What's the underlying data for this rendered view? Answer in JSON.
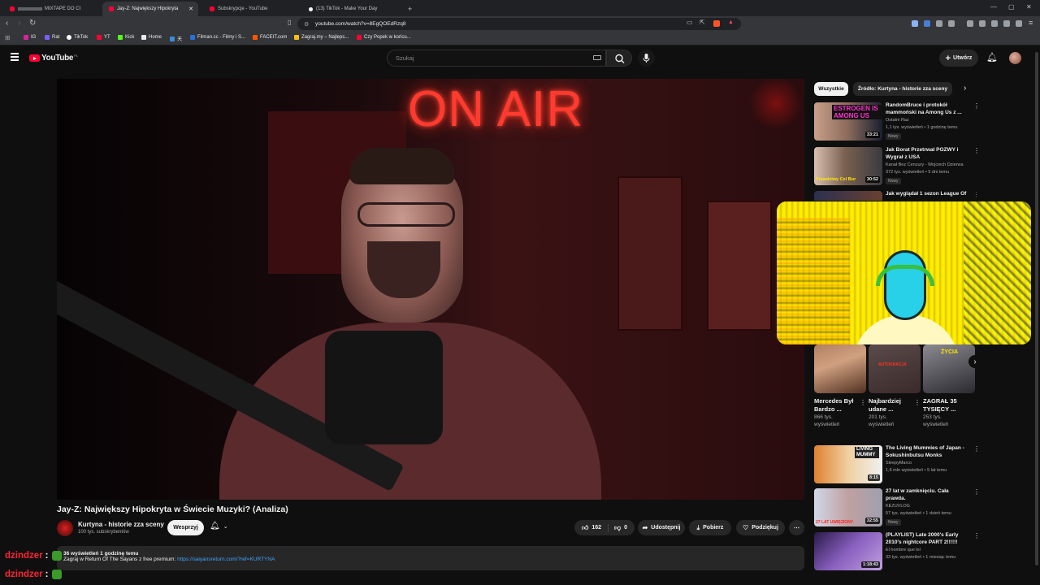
{
  "browser": {
    "tabs": [
      {
        "label": "MIXTAPE DO CI",
        "favicon": "youtube-favicon"
      },
      {
        "label": "Jay-Z: Największy Hipokryta",
        "favicon": "youtube-favicon"
      },
      {
        "label": "Subskrypcje - YouTube",
        "favicon": "youtube-favicon"
      },
      {
        "label": "(13) TikTok - Make Your Day",
        "favicon": "tiktok-favicon"
      }
    ],
    "new_tab": "+",
    "url": "youtube.com/watch?v=8EgQOEdRzq8",
    "bookmarks": [
      {
        "label": "IG",
        "color": "#d6249f"
      },
      {
        "label": "Rat",
        "color": "#7b5cff"
      },
      {
        "label": "TikTok",
        "color": "#ffffff"
      },
      {
        "label": "YT",
        "color": "#ff0033"
      },
      {
        "label": "Kick",
        "color": "#53fc18"
      },
      {
        "label": "Home",
        "color": "#e8eaed"
      },
      {
        "label": "天",
        "color": "#3a8fd8"
      },
      {
        "label": "Filman.cc - Filmy i S...",
        "color": "#2a6fd8"
      },
      {
        "label": "FACEIT.com",
        "color": "#ff5500"
      },
      {
        "label": "Zagraj.my – Najleps...",
        "color": "#f4c20d"
      },
      {
        "label": "Czy Popek w końcu...",
        "color": "#ff0033"
      }
    ]
  },
  "youtube": {
    "logo_text": "YouTube",
    "country": "PL",
    "search_placeholder": "Szukaj",
    "create_label": "Utwórz",
    "brand_color": "#ff0033"
  },
  "video": {
    "sign_text": "ON AIR",
    "title": "Jay-Z: Największy Hipokryta w Świecie Muzyki? (Analiza)",
    "channel": "Kurtyna - historie zza sceny",
    "subscribers": "100 tys. subskrybentów",
    "support_label": "Wesprzyj",
    "likes": "162",
    "dislikes": "0",
    "share_label": "Udostępnij",
    "download_label": "Pobierz",
    "thanks_label": "Podziękuj",
    "views_time": "36 wyświetleń  1 godzinę temu",
    "desc_line": "Zagraj w Return Of The Sayans z free premium:",
    "desc_link": "https://saiyansreturn.com/?ref=KURTYNA"
  },
  "chat": [
    {
      "user": "dzindzer",
      "sep": ":"
    },
    {
      "user": "dzindzer",
      "sep": ":"
    }
  ],
  "sidebar": {
    "chips": [
      "Wszystkie",
      "Źródło: Kurtyna - historie zza sceny"
    ],
    "videos_top": [
      {
        "title": "RandomBruce i protokół mammoński na Among Us z ...",
        "channel": "Ostatni Raz",
        "meta": "1,1 tys. wyświetleń • 1 godzinę temu",
        "badge": "Nowy",
        "duration": "33:21",
        "thumb_text": "ESTROGEN IS AMONG US"
      },
      {
        "title": "Jak Borat Przetrwał POZWY i Wygrał z USA",
        "channel": "Kanał Bez Cenzury - Wojciech Dzierwa",
        "meta": "372 tys. wyświetleń • 5 dni temu",
        "badge": "Nowy",
        "duration": "30:52",
        "thumb_text": "Prawdziwy Cel Bor"
      },
      {
        "title": "Jak wyglądał 1 sezon League Of",
        "channel": "",
        "meta": "",
        "badge": "",
        "duration": "",
        "thumb_text": ""
      }
    ],
    "shorts": [
      {
        "title": "Mercedes Był Bardzo ...",
        "views": "866 tys. wyświetleń"
      },
      {
        "title": "Najbardziej udane ...",
        "views": "201 tys. wyświetleń"
      },
      {
        "title": "ZAGRAŁ 35 TYSIĘCY ...",
        "views": "253 tys. wyświetleń"
      }
    ],
    "short_thumb_texts": [
      "",
      "AUTOKRACJA",
      "ŻYCIA"
    ],
    "videos_bottom": [
      {
        "title": "The Living Mummies of Japan - Sokushinbutsu Monks",
        "channel": "SleepyMarco",
        "meta": "1,6 mln wyświetleń • 5 lat temu",
        "badge": "",
        "duration": "8:15",
        "thumb_text": "LIVING MUMMY"
      },
      {
        "title": "27 lat w zamknięciu. Cała prawda.",
        "channel": "KEZUVLOG",
        "meta": "57 tys. wyświetleń • 1 dzień temu",
        "badge": "Nowy",
        "duration": "32:55",
        "thumb_text": "27 LAT UWIĘZIONY"
      },
      {
        "title": "(PLAYLIST) Late 2000's Early 2010's nightcore PART 2!!!!!!",
        "channel": "El hombre que lol",
        "meta": "33 tys. wyświetleń • 1 miesiąc temu",
        "badge": "",
        "duration": "1:18:43",
        "thumb_text": ""
      }
    ]
  }
}
